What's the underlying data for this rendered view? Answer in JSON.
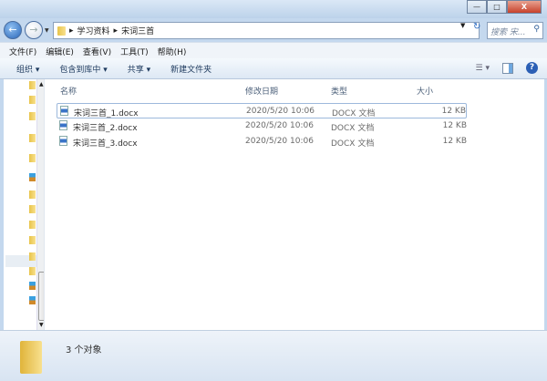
{
  "window": {
    "minimize": "—",
    "maximize": "□",
    "close": "X"
  },
  "address": {
    "segments": [
      "学习资料",
      "宋词三首"
    ],
    "separator": "▸",
    "search_placeholder": "搜索 宋..."
  },
  "menu": [
    "文件(F)",
    "编辑(E)",
    "查看(V)",
    "工具(T)",
    "帮助(H)"
  ],
  "toolbar": {
    "organize": "组织 ▾",
    "include_library": "包含到库中 ▾",
    "share": "共享 ▾",
    "new_folder": "新建文件夹",
    "help": "?"
  },
  "columns": {
    "name": "名称",
    "modified": "修改日期",
    "type": "类型",
    "size": "大小"
  },
  "files": [
    {
      "name": "宋词三首_1.docx",
      "modified": "2020/5/20 10:06",
      "type": "DOCX 文档",
      "size": "12 KB"
    },
    {
      "name": "宋词三首_2.docx",
      "modified": "2020/5/20 10:06",
      "type": "DOCX 文档",
      "size": "12 KB"
    },
    {
      "name": "宋词三首_3.docx",
      "modified": "2020/5/20 10:06",
      "type": "DOCX 文档",
      "size": "12 KB"
    }
  ],
  "status": {
    "count": "3 个对象"
  }
}
